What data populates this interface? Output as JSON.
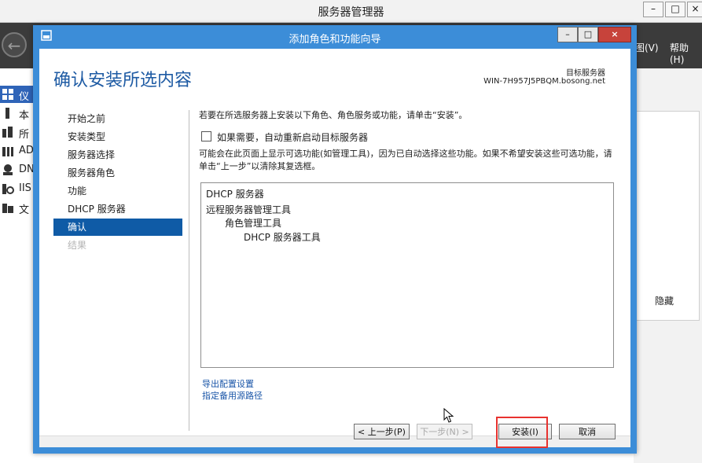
{
  "server_manager": {
    "title": "服务器管理器",
    "controls": {
      "minimize": "–",
      "maximize": "□",
      "close": "×"
    },
    "menu": {
      "view": "图(V)",
      "help": "帮助(H)"
    },
    "sidebar": [
      {
        "label": "仪",
        "icon": "dashboard-icon"
      },
      {
        "label": "本",
        "icon": "local-server-icon"
      },
      {
        "label": "所",
        "icon": "all-servers-icon"
      },
      {
        "label": "AD",
        "icon": "ad-icon"
      },
      {
        "label": "DN",
        "icon": "dns-icon"
      },
      {
        "label": "IIS",
        "icon": "iis-icon"
      },
      {
        "label": "文",
        "icon": "file-services-icon"
      }
    ],
    "hide_label": "隐藏"
  },
  "wizard": {
    "title": "添加角色和功能向导",
    "controls": {
      "minimize": "–",
      "maximize": "□",
      "close": "×"
    },
    "heading": "确认安装所选内容",
    "target_label": "目标服务器",
    "target_name": "WIN-7H957J5PBQM.bosong.net",
    "steps": [
      {
        "label": "开始之前",
        "state": "normal"
      },
      {
        "label": "安装类型",
        "state": "normal"
      },
      {
        "label": "服务器选择",
        "state": "normal"
      },
      {
        "label": "服务器角色",
        "state": "normal"
      },
      {
        "label": "功能",
        "state": "normal"
      },
      {
        "label": "DHCP 服务器",
        "state": "normal"
      },
      {
        "label": "确认",
        "state": "active"
      },
      {
        "label": "结果",
        "state": "disabled"
      }
    ],
    "intro": "若要在所选服务器上安装以下角色、角色服务或功能，请单击“安装”。",
    "restart_checkbox": {
      "label": "如果需要，自动重新启动目标服务器",
      "checked": false
    },
    "note": "可能会在此页面上显示可选功能(如管理工具)，因为已自动选择这些功能。如果不希望安装这些可选功能，请单击“上一步”以清除其复选框。",
    "features": [
      {
        "label": "DHCP 服务器",
        "level": 0
      },
      {
        "label": "远程服务器管理工具",
        "level": 0
      },
      {
        "label": "角色管理工具",
        "level": 1
      },
      {
        "label": "DHCP 服务器工具",
        "level": 2
      }
    ],
    "links": {
      "export": "导出配置设置",
      "alternate_source": "指定备用源路径"
    },
    "buttons": {
      "previous": "< 上一步(P)",
      "next": "下一步(N) >",
      "install": "安装(I)",
      "cancel": "取消"
    }
  },
  "colors": {
    "wizard_frame": "#3c8dd8",
    "heading": "#1d5aa3",
    "active_step": "#0f5ba6",
    "link": "#1a56a8",
    "highlight": "#e8322f"
  }
}
